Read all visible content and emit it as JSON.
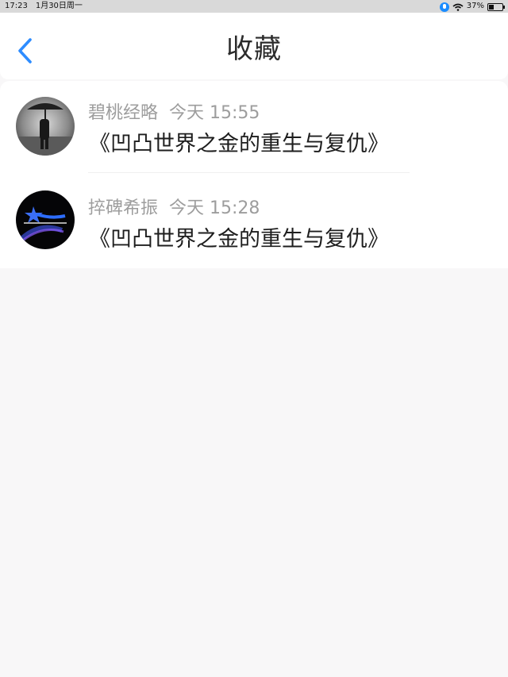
{
  "status_bar": {
    "time": "17:23",
    "date": "1月30日周一",
    "battery": "37%"
  },
  "header": {
    "title": "收藏"
  },
  "favorites": [
    {
      "author": "碧桃经略",
      "time": "今天 15:55",
      "title": "《凹凸世界之金的重生与复仇》",
      "avatar_icon": "person-with-umbrella-avatar"
    },
    {
      "author": "捽碑希振",
      "time": "今天 15:28",
      "title": "《凹凸世界之金的重生与复仇》",
      "avatar_icon": "shooting-star-avatar"
    }
  ],
  "colors": {
    "accent": "#2d8cff",
    "background": "#f8f7f8"
  }
}
